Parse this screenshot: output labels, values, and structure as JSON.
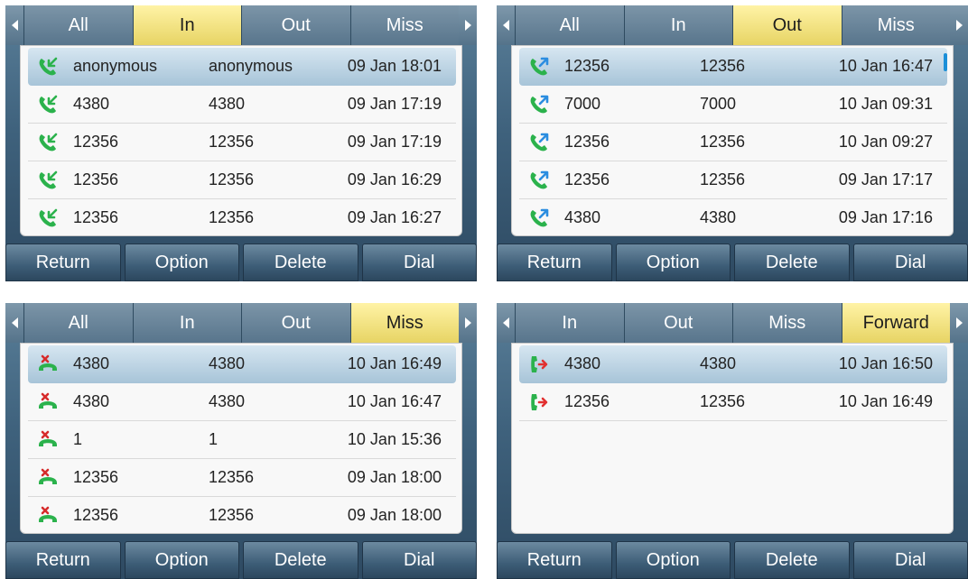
{
  "colors": {
    "selected_tab": "#ecd96d",
    "incoming_icon": "#2bb24c",
    "outgoing_icon_arrow": "#2b8de0",
    "missed_icon_x": "#d62b2b",
    "forward_icon_arrow": "#e23030",
    "handset": "#2bb24c"
  },
  "softkeys": [
    "Return",
    "Option",
    "Delete",
    "Dial"
  ],
  "screens": [
    {
      "tabs": [
        "All",
        "In",
        "Out",
        "Miss"
      ],
      "selected_tab": "In",
      "call_type_icon": "incoming-call-icon",
      "rows": [
        {
          "name": "anonymous",
          "number": "anonymous",
          "time": "09 Jan 18:01",
          "selected": true
        },
        {
          "name": "4380",
          "number": "4380",
          "time": "09 Jan 17:19"
        },
        {
          "name": "12356",
          "number": "12356",
          "time": "09 Jan 17:19"
        },
        {
          "name": "12356",
          "number": "12356",
          "time": "09 Jan 16:29"
        },
        {
          "name": "12356",
          "number": "12356",
          "time": "09 Jan 16:27"
        }
      ]
    },
    {
      "tabs": [
        "All",
        "In",
        "Out",
        "Miss"
      ],
      "selected_tab": "Out",
      "call_type_icon": "outgoing-call-icon",
      "rows": [
        {
          "name": "12356",
          "number": "12356",
          "time": "10 Jan 16:47",
          "selected": true
        },
        {
          "name": "7000",
          "number": "7000",
          "time": "10 Jan 09:31"
        },
        {
          "name": "12356",
          "number": "12356",
          "time": "10 Jan 09:27"
        },
        {
          "name": "12356",
          "number": "12356",
          "time": "09 Jan 17:17"
        },
        {
          "name": "4380",
          "number": "4380",
          "time": "09 Jan 17:16"
        }
      ]
    },
    {
      "tabs": [
        "All",
        "In",
        "Out",
        "Miss"
      ],
      "selected_tab": "Miss",
      "call_type_icon": "missed-call-icon",
      "rows": [
        {
          "name": "4380",
          "number": "4380",
          "time": "10 Jan 16:49",
          "selected": true
        },
        {
          "name": "4380",
          "number": "4380",
          "time": "10 Jan 16:47"
        },
        {
          "name": "1",
          "number": "1",
          "time": "10 Jan 15:36"
        },
        {
          "name": "12356",
          "number": "12356",
          "time": "09 Jan 18:00"
        },
        {
          "name": "12356",
          "number": "12356",
          "time": "09 Jan 18:00"
        }
      ]
    },
    {
      "tabs": [
        "In",
        "Out",
        "Miss",
        "Forward"
      ],
      "selected_tab": "Forward",
      "call_type_icon": "forwarded-call-icon",
      "rows": [
        {
          "name": "4380",
          "number": "4380",
          "time": "10 Jan 16:50",
          "selected": true
        },
        {
          "name": "12356",
          "number": "12356",
          "time": "10 Jan 16:49"
        }
      ]
    }
  ]
}
